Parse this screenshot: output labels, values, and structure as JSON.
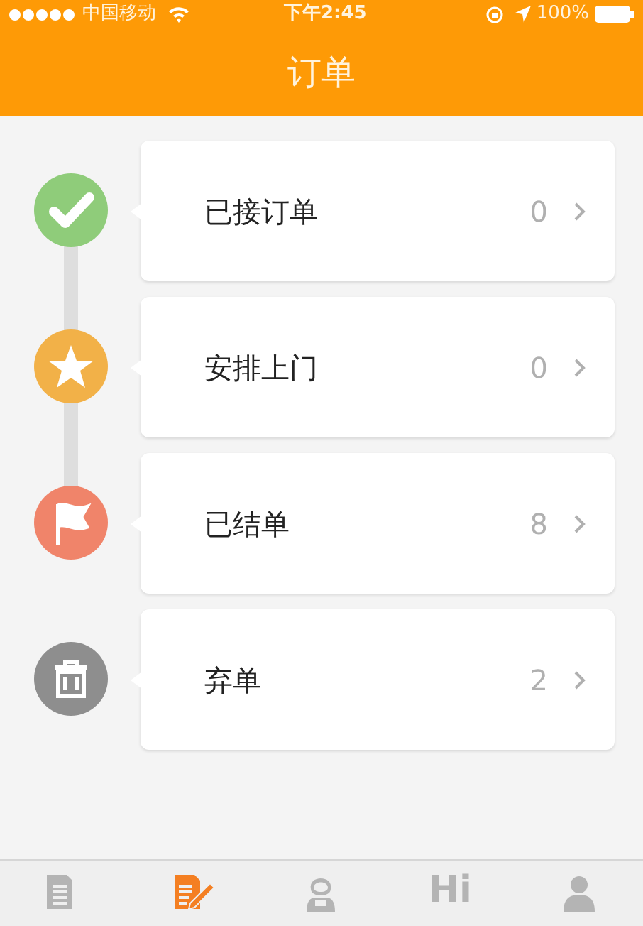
{
  "status_bar": {
    "carrier": "中国移动",
    "time": "下午2:45",
    "battery": "100%"
  },
  "header": {
    "title": "订单"
  },
  "orders": [
    {
      "kind": "check",
      "color": "#8fcc7a",
      "label": "已接订单",
      "count": "0",
      "connected": true
    },
    {
      "kind": "star",
      "color": "#f2b148",
      "label": "安排上门",
      "count": "0",
      "connected": true
    },
    {
      "kind": "flag",
      "color": "#f0846a",
      "label": "已结单",
      "count": "8",
      "connected": false
    },
    {
      "kind": "trash",
      "color": "#8e8e8e",
      "label": "弃单",
      "count": "2",
      "connected": false
    }
  ],
  "tab_bar": [
    {
      "kind": "documents",
      "selected": false
    },
    {
      "kind": "edit",
      "selected": true
    },
    {
      "kind": "person",
      "selected": false
    },
    {
      "kind": "text",
      "text": "Hi",
      "selected": false
    },
    {
      "kind": "user",
      "selected": false
    }
  ]
}
